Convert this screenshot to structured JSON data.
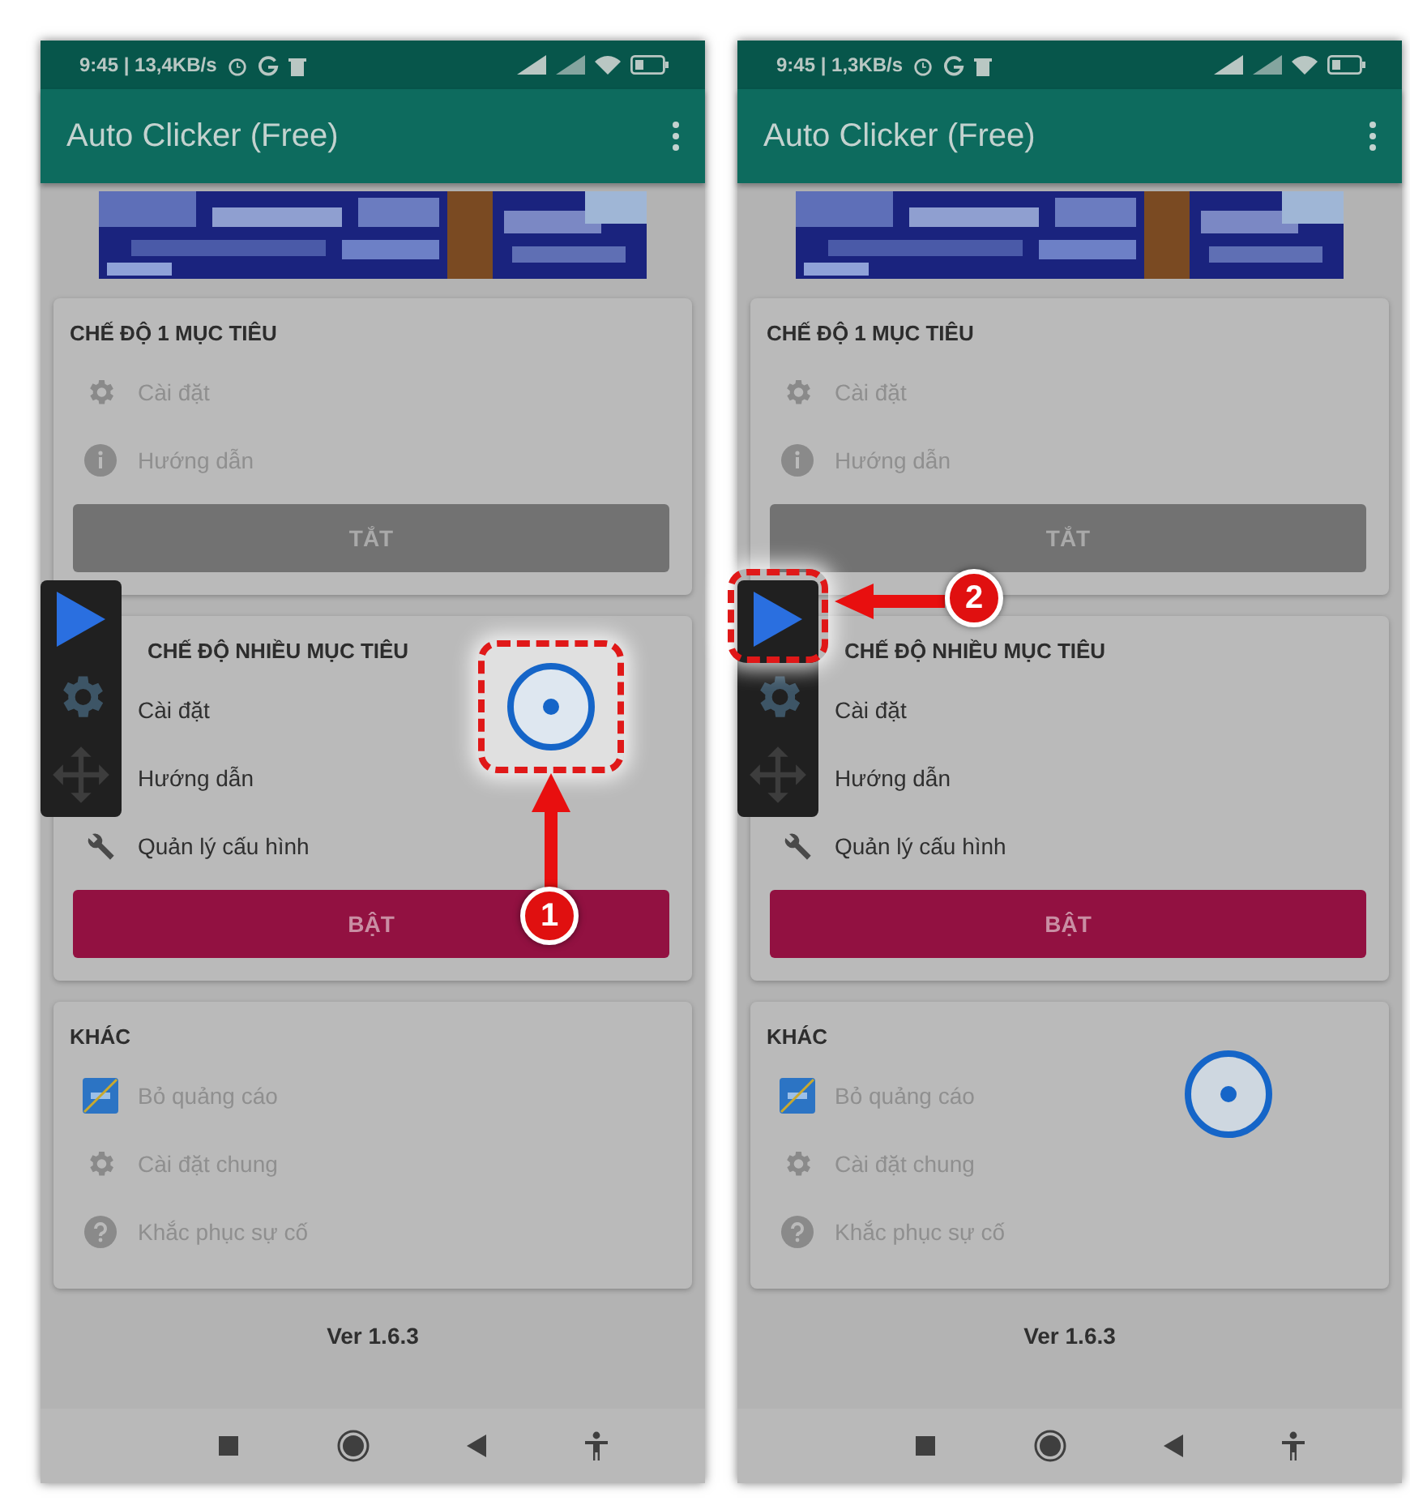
{
  "screens": [
    {
      "status_bar": {
        "time": "9:45 | 13,4KB/s"
      },
      "app_bar": {
        "title": "Auto Clicker (Free)"
      },
      "sections": [
        {
          "title": "CHẾ ĐỘ 1 MỤC TIÊU",
          "items": [
            {
              "label": "Cài đặt",
              "disabled": true
            },
            {
              "label": "Hướng dẫn",
              "disabled": true
            }
          ],
          "button": {
            "label": "TẮT",
            "kind": "off"
          }
        },
        {
          "title": "CHẾ ĐỘ NHIỀU MỤC TIÊU",
          "items": [
            {
              "label": "Cài đặt",
              "disabled": false
            },
            {
              "label": "Hướng dẫn",
              "disabled": false
            },
            {
              "label": "Quản lý cấu hình",
              "disabled": false
            }
          ],
          "button": {
            "label": "BẬT",
            "kind": "on"
          }
        },
        {
          "title": "KHÁC",
          "items": [
            {
              "label": "Bỏ quảng cáo",
              "disabled": true
            },
            {
              "label": "Cài đặt chung",
              "disabled": true
            },
            {
              "label": "Khắc phục sự cố",
              "disabled": true
            }
          ]
        }
      ],
      "version": "Ver 1.6.3",
      "callout": {
        "number": "1",
        "kind": "target"
      }
    },
    {
      "status_bar": {
        "time": "9:45 | 1,3KB/s"
      },
      "app_bar": {
        "title": "Auto Clicker (Free)"
      },
      "sections": [
        {
          "title": "CHẾ ĐỘ 1 MỤC TIÊU",
          "items": [
            {
              "label": "Cài đặt",
              "disabled": true
            },
            {
              "label": "Hướng dẫn",
              "disabled": true
            }
          ],
          "button": {
            "label": "TẮT",
            "kind": "off"
          }
        },
        {
          "title": "CHẾ ĐỘ NHIỀU MỤC TIÊU",
          "items": [
            {
              "label": "Cài đặt",
              "disabled": false
            },
            {
              "label": "Hướng dẫn",
              "disabled": false
            },
            {
              "label": "Quản lý cấu hình",
              "disabled": false
            }
          ],
          "button": {
            "label": "BẬT",
            "kind": "on"
          }
        },
        {
          "title": "KHÁC",
          "items": [
            {
              "label": "Bỏ quảng cáo",
              "disabled": true
            },
            {
              "label": "Cài đặt chung",
              "disabled": true
            },
            {
              "label": "Khắc phục sự cố",
              "disabled": true
            }
          ]
        }
      ],
      "version": "Ver 1.6.3",
      "callout": {
        "number": "2",
        "kind": "play"
      }
    }
  ]
}
